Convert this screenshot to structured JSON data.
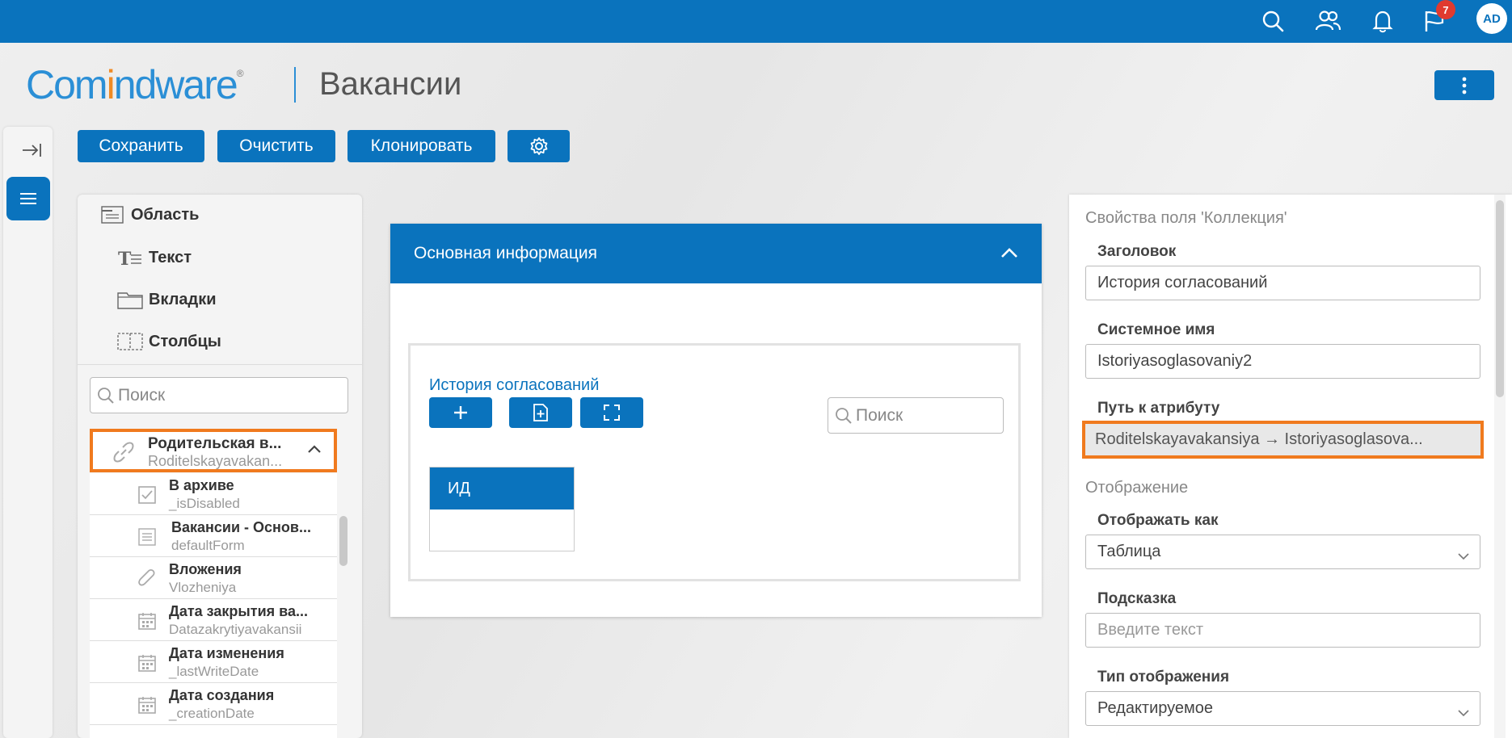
{
  "topbar": {
    "icons": [
      "search-icon",
      "users-icon",
      "bell-icon",
      "flag-icon"
    ],
    "notification_count": "7",
    "avatar_initials": "AD"
  },
  "header": {
    "logo_part1": "Com",
    "logo_part2": "i",
    "logo_part3": "ndware",
    "logo_mark": "®",
    "page_title": "Вакансии"
  },
  "toolbar": {
    "save": "Сохранить",
    "clear": "Очистить",
    "clone": "Клонировать"
  },
  "palette": {
    "items": [
      "Область",
      "Текст",
      "Вкладки",
      "Столбцы"
    ],
    "search_placeholder": "Поиск"
  },
  "tree": {
    "parent": {
      "title": "Родительская в...",
      "sub": "Roditelskayavakan..."
    },
    "items": [
      {
        "title": "В архиве",
        "sub": "_isDisabled",
        "icon": "checkbox-icon"
      },
      {
        "title": "Вакансии - Основ...",
        "sub": "defaultForm",
        "icon": "form-icon"
      },
      {
        "title": "Вложения",
        "sub": "Vlozheniya",
        "icon": "paperclip-icon"
      },
      {
        "title": "Дата закрытия ва...",
        "sub": "Datazakrytiyavakansii",
        "icon": "calendar-icon"
      },
      {
        "title": "Дата изменения",
        "sub": "_lastWriteDate",
        "icon": "calendar-icon"
      },
      {
        "title": "Дата создания",
        "sub": "_creationDate",
        "icon": "calendar-icon"
      }
    ]
  },
  "card": {
    "header": "Основная информация",
    "collection_title": "История согласований",
    "search_placeholder": "Поиск",
    "column_header": "ИД"
  },
  "properties": {
    "title": "Свойства поля 'Коллекция'",
    "caption_label": "Заголовок",
    "caption_value": "История согласований",
    "sysname_label": "Системное имя",
    "sysname_value": "Istoriyasoglasovaniy2",
    "path_label": "Путь к атрибуту",
    "path_value": "Roditelskayavakansiya → Istoriyasoglasova...",
    "display_section": "Отображение",
    "display_as_label": "Отображать как",
    "display_as_value": "Таблица",
    "hint_label": "Подсказка",
    "hint_placeholder": "Введите текст",
    "display_type_label": "Тип отображения",
    "display_type_value": "Редактируемое"
  }
}
